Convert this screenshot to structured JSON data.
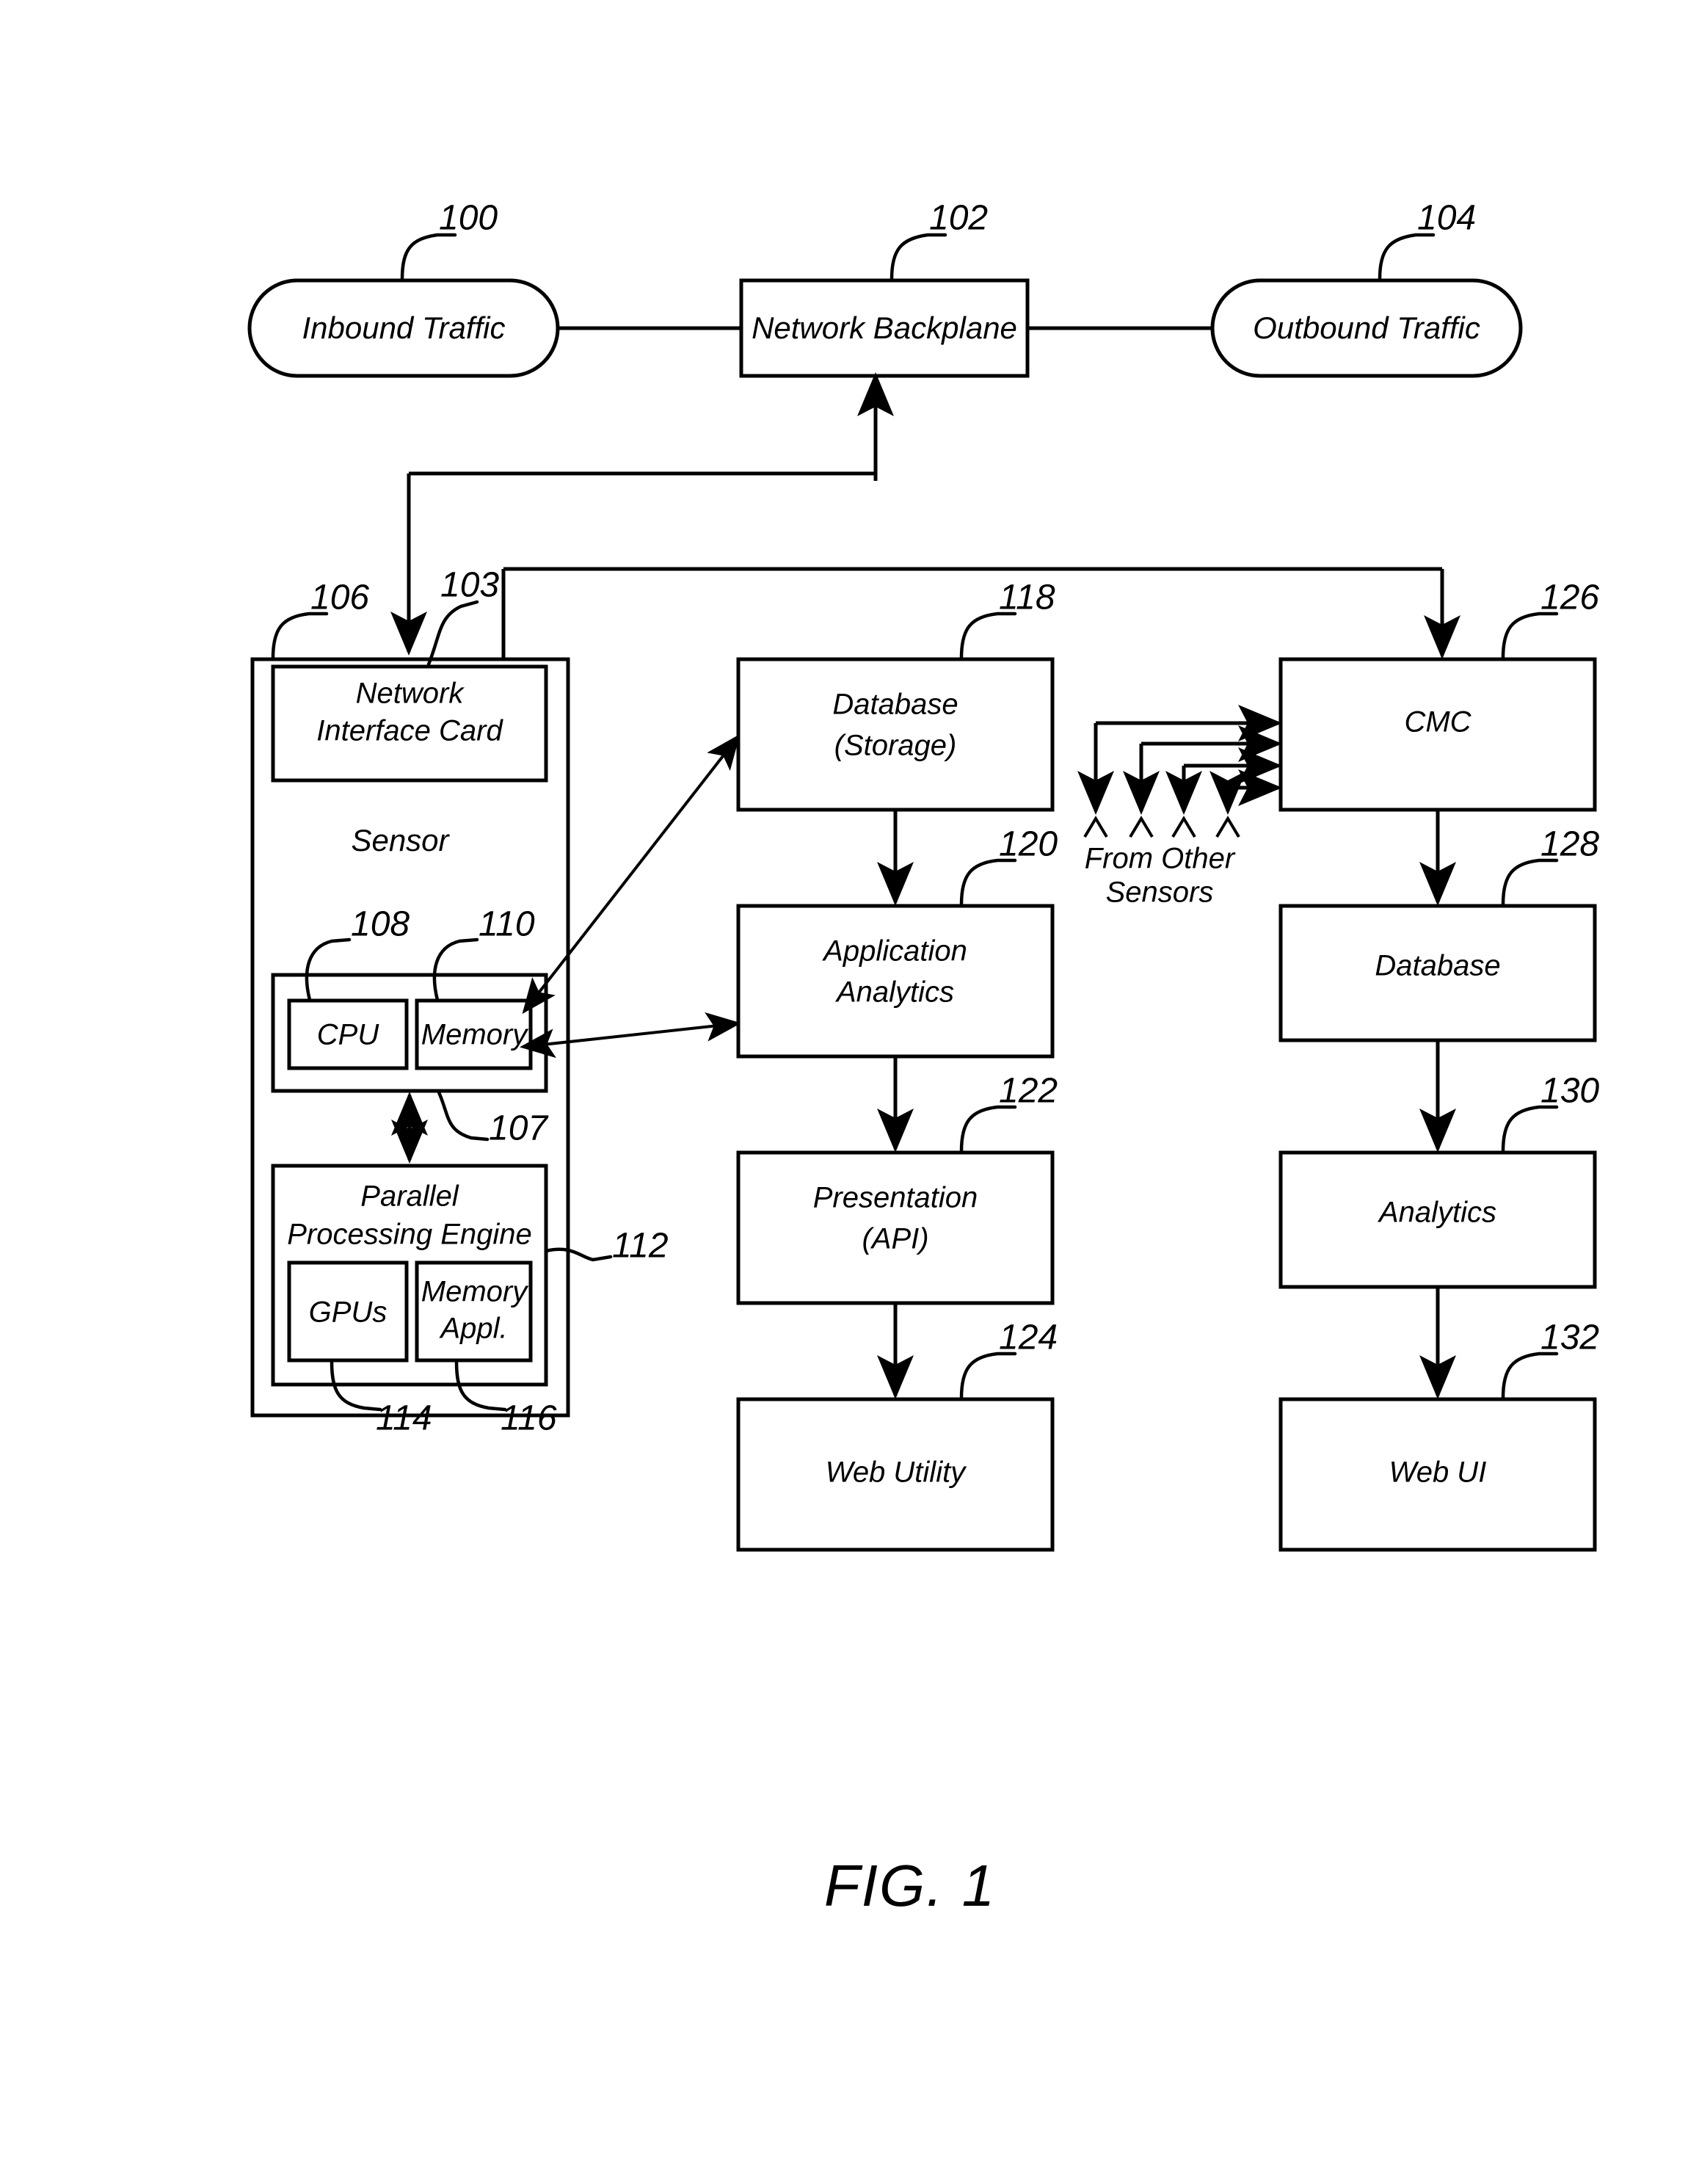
{
  "figure": {
    "caption": "FIG. 1",
    "title": "Network sensor and analytics architecture block diagram"
  },
  "nodes": {
    "inbound_traffic": {
      "label": "Inbound Traffic",
      "ref": "100",
      "shape": "stadium"
    },
    "network_backplane": {
      "label": "Network Backplane",
      "ref": "102",
      "shape": "rect"
    },
    "outbound_traffic": {
      "label": "Outbound Traffic",
      "ref": "104",
      "shape": "stadium"
    },
    "sensor": {
      "label": "Sensor",
      "ref": "106",
      "shape": "rect"
    },
    "network_interface_card": {
      "label_line1": "Network",
      "label_line2": "Interface Card",
      "ref": "103",
      "shape": "rect"
    },
    "cpu": {
      "label": "CPU",
      "ref": "108",
      "shape": "rect"
    },
    "memory": {
      "label": "Memory",
      "ref": "110",
      "shape": "rect"
    },
    "bus_107": {
      "ref": "107"
    },
    "parallel_processing_engine": {
      "label_line1": "Parallel",
      "label_line2": "Processing Engine",
      "ref": "112",
      "shape": "rect"
    },
    "gpus": {
      "label": "GPUs",
      "ref": "114",
      "shape": "rect"
    },
    "memory_appl": {
      "label_line1": "Memory",
      "label_line2": "Appl.",
      "ref": "116",
      "shape": "rect"
    },
    "database_storage": {
      "label_line1": "Database",
      "label_line2": "(Storage)",
      "ref": "118",
      "shape": "rect"
    },
    "application_analytics": {
      "label_line1": "Application",
      "label_line2": "Analytics",
      "ref": "120",
      "shape": "rect"
    },
    "presentation_api": {
      "label_line1": "Presentation",
      "label_line2": "(API)",
      "ref": "122",
      "shape": "rect"
    },
    "web_utility": {
      "label": "Web Utility",
      "ref": "124",
      "shape": "rect"
    },
    "cmc": {
      "label": "CMC",
      "ref": "126",
      "shape": "rect"
    },
    "cmc_database": {
      "label": "Database",
      "ref": "128",
      "shape": "rect"
    },
    "cmc_analytics": {
      "label": "Analytics",
      "ref": "130",
      "shape": "rect"
    },
    "web_ui": {
      "label": "Web UI",
      "ref": "132",
      "shape": "rect"
    }
  },
  "annotations": {
    "from_other_sensors": {
      "line1": "From Other",
      "line2": "Sensors",
      "arrow_count": 4
    }
  },
  "colors": {
    "stroke": "#000000",
    "background": "#ffffff",
    "text": "#000000"
  }
}
